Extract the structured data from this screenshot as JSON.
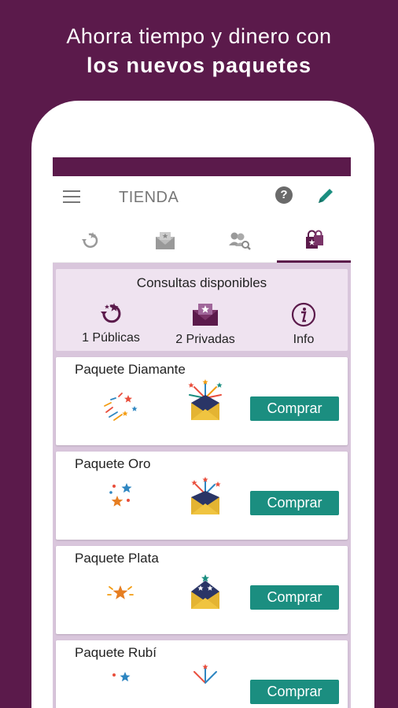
{
  "headline": {
    "line1": "Ahorra tiempo y dinero con",
    "line2": "los nuevos paquetes"
  },
  "appbar": {
    "title": "TIENDA",
    "help_glyph": "?"
  },
  "tabs": [
    {
      "name": "public-consults",
      "active": false
    },
    {
      "name": "private-consults",
      "active": false
    },
    {
      "name": "search-experts",
      "active": false
    },
    {
      "name": "store",
      "active": true
    }
  ],
  "summary": {
    "title": "Consultas disponibles",
    "publicas": "1 Públicas",
    "privadas": "2 Privadas",
    "info": "Info"
  },
  "packages": [
    {
      "name": "Paquete Diamante",
      "buy": "Comprar"
    },
    {
      "name": "Paquete Oro",
      "buy": "Comprar"
    },
    {
      "name": "Paquete Plata",
      "buy": "Comprar"
    },
    {
      "name": "Paquete Rubí",
      "buy": "Comprar"
    }
  ],
  "colors": {
    "brand": "#5b1a4b",
    "accent": "#1b8e80",
    "panel": "#efe3f0",
    "envelope": "#e4b432"
  }
}
